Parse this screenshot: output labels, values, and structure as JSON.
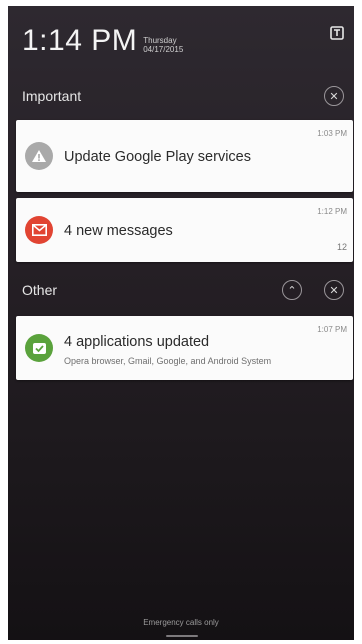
{
  "status_bar": {
    "time": "1:14 PM",
    "day": "Thursday",
    "date": "04/17/2015"
  },
  "sections": {
    "important": {
      "label": "Important"
    },
    "other": {
      "label": "Other"
    }
  },
  "notifications": [
    {
      "title": "Update Google Play services",
      "time": "1:03 PM",
      "icon": "warning-triangle-icon",
      "icon_color": "#a9a9a9"
    },
    {
      "title": "4 new messages",
      "time": "1:12 PM",
      "count": "12",
      "icon": "mail-icon",
      "icon_color": "#e14432"
    },
    {
      "title": "4 applications updated",
      "time": "1:07 PM",
      "subtitle": "Opera browser, Gmail, Google, and Android System",
      "icon": "update-check-icon",
      "icon_color": "#5aa23c"
    }
  ],
  "footer": {
    "text": "Emergency calls only"
  },
  "colors": {
    "background_top": "#2e2930",
    "background_bottom": "#141114",
    "card": "#fbfbfb"
  }
}
